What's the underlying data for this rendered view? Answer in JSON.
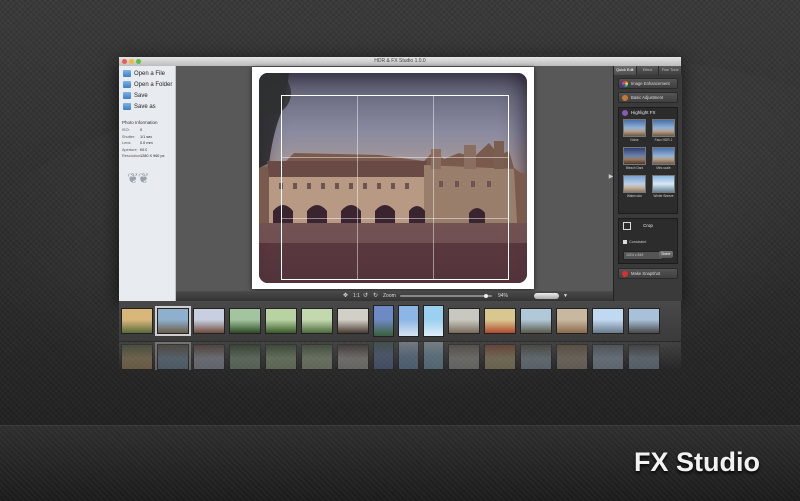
{
  "window": {
    "title": "HDR & FX Studio 1.0.0"
  },
  "sidebar": {
    "items": [
      {
        "label": "Open a File",
        "icon": "file-icon"
      },
      {
        "label": "Open a Folder",
        "icon": "folder-icon"
      },
      {
        "label": "Save",
        "icon": "save-icon"
      },
      {
        "label": "Save as",
        "icon": "save-as-icon"
      }
    ],
    "photo_info": {
      "title": "Photo Information",
      "rows": [
        {
          "k": "ISO:",
          "v": "0"
        },
        {
          "k": "Shutter:",
          "v": "1/1 sec"
        },
        {
          "k": "Lens:",
          "v": "0.0 mm"
        },
        {
          "k": "Aperture:",
          "v": "f/0.0"
        },
        {
          "k": "Resolution:",
          "v": "1280 X 960 px"
        }
      ]
    }
  },
  "zoombar": {
    "ratio_label": "1:1",
    "zoom_label": "Zoom",
    "zoom_value": "94%",
    "zoom_fraction": 0.94
  },
  "right_panel": {
    "tabs": [
      "Quick Edit",
      "Effect",
      "Fine Tune"
    ],
    "buttons": [
      {
        "label": "Image Enhancement",
        "icon": "enhance-icon"
      },
      {
        "label": "Basic Adjustment",
        "icon": "adjust-icon"
      }
    ],
    "highlight": {
      "title": "Highlight FX",
      "items": [
        "Noise",
        "Faux HDR-1",
        "Bleach Dark",
        "Mini-scale",
        "Watercolor",
        "Winter Breeze"
      ]
    },
    "crop": {
      "title": "Crop",
      "constraint_label": "Constraint",
      "dimensions": "1024 x 819",
      "done_label": "Done"
    },
    "snapshot_label": "Make Snapshot"
  },
  "filmstrip": {
    "thumbs": [
      {
        "c1": "#d9b77a",
        "c2": "#5a6a3a",
        "type": "land"
      },
      {
        "c1": "#8fb0cc",
        "c2": "#6b5c4a",
        "type": "land",
        "selected": true
      },
      {
        "c1": "#c7cfe0",
        "c2": "#6e4a3c",
        "type": "land"
      },
      {
        "c1": "#a4c4a0",
        "c2": "#2c4b24",
        "type": "land"
      },
      {
        "c1": "#b8d2a2",
        "c2": "#3a5a2a",
        "type": "land"
      },
      {
        "c1": "#c4d8b0",
        "c2": "#4a6a3a",
        "type": "land"
      },
      {
        "c1": "#d2cfc6",
        "c2": "#4b3b33",
        "type": "land"
      },
      {
        "c1": "#6e8ac4",
        "c2": "#3b5e3c",
        "type": "port"
      },
      {
        "c1": "#8cb6e6",
        "c2": "#d8e6f2",
        "type": "port"
      },
      {
        "c1": "#9ad0f0",
        "c2": "#e0eef8",
        "type": "port"
      },
      {
        "c1": "#c8c8c0",
        "c2": "#7c6a5c",
        "type": "land"
      },
      {
        "c1": "#d8c890",
        "c2": "#b04a2c",
        "type": "land"
      },
      {
        "c1": "#b0c8d8",
        "c2": "#5a5a4a",
        "type": "land"
      },
      {
        "c1": "#c8b8a0",
        "c2": "#8a6a4a",
        "type": "land"
      },
      {
        "c1": "#c0d8f0",
        "c2": "#6a7a8a",
        "type": "land"
      },
      {
        "c1": "#a8c0d8",
        "c2": "#4a4a4a",
        "type": "land"
      }
    ]
  },
  "brand": {
    "label": "FX Studio"
  }
}
